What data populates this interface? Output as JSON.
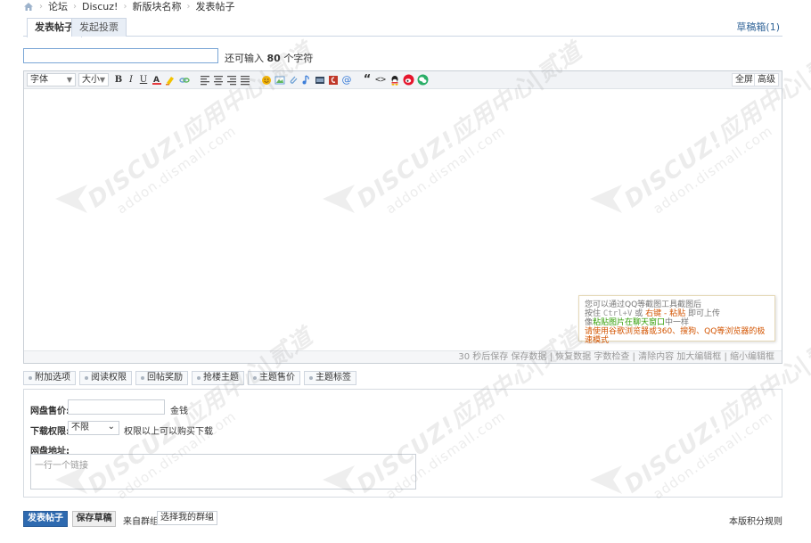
{
  "breadcrumb": {
    "items": [
      "论坛",
      "Discuz!",
      "新版块名称",
      "发表帖子"
    ]
  },
  "tabs": {
    "post": "发表帖子",
    "poll": "发起投票",
    "drafts": "草稿箱(1)"
  },
  "title": {
    "value": "",
    "hint_prefix": "还可输入",
    "hint_count": "80",
    "hint_suffix": "个字符"
  },
  "toolbar": {
    "font": "字体",
    "size": "大小",
    "fullscreen": "全屏",
    "advanced": "高级",
    "icons": [
      "bold-icon",
      "italic-icon",
      "underline-icon",
      "font-color-icon",
      "highlight-icon",
      "link-icon",
      "align-left-icon",
      "align-center-icon",
      "align-right-icon",
      "align-justify-icon",
      "emoji-icon",
      "image-icon",
      "attachment-icon",
      "music-icon",
      "video-icon",
      "flash-icon",
      "mention-icon",
      "quote-icon",
      "code-icon",
      "qq-icon",
      "weibo-icon",
      "wechat-icon"
    ]
  },
  "editor": {
    "status": "30 秒后保存 保存数据 | 恢复数据    字数检查 | 清除内容    加大编辑框 | 缩小编辑框",
    "tip": {
      "line1": "您可以通过QQ等截图工具截图后",
      "line2_a": "按住 ",
      "line2_code": "Ctrl+V",
      "line2_b": " 或 ",
      "line2_hl": "右键 - 粘贴",
      "line2_c": " 即可上传",
      "line3_a": "像",
      "line3_hl": "粘贴图片在聊天窗口",
      "line3_b": "中一样",
      "line4": "请使用谷歌浏览器或360、搜狗、QQ等浏览器的极速模式"
    }
  },
  "options": [
    "附加选项",
    "阅读权限",
    "回帖奖励",
    "抢楼主题",
    "主题售价",
    "主题标签"
  ],
  "form": {
    "price_label": "网盘售价:",
    "price_value": "",
    "price_unit": "金钱",
    "perm_label": "下载权限:",
    "perm_value": "不限",
    "perm_suffix": "权限以上可以购买下载",
    "addr_label": "网盘地址:",
    "addr_placeholder": "一行一个链接"
  },
  "footer": {
    "submit": "发表帖子",
    "save_draft": "保存草稿",
    "group_label": "来自群组:",
    "group_value": "选择我的群组",
    "rules": "本版积分规则"
  },
  "watermark": {
    "brand": "DISCUZ!应用中心|贰道",
    "domain": "addon.dismall.com"
  },
  "colors": {
    "primary": "#2e6ab0",
    "link": "#336699",
    "warning": "#d35400",
    "success": "#2e9c00"
  }
}
